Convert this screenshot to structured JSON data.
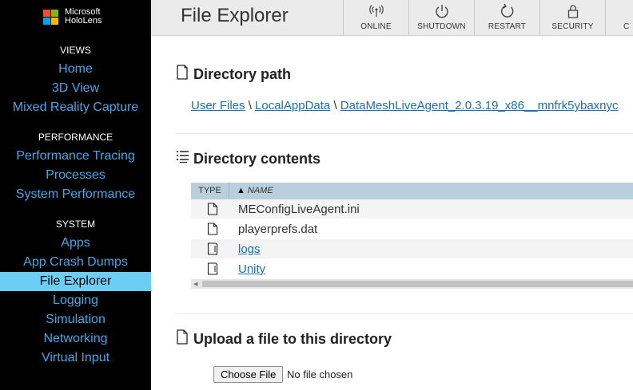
{
  "logo": {
    "line1": "Microsoft",
    "line2": "HoloLens",
    "colors": [
      "#f25022",
      "#7fba00",
      "#00a4ef",
      "#ffb900"
    ]
  },
  "sidebar": {
    "sections": [
      {
        "heading": "VIEWS",
        "items": [
          "Home",
          "3D View",
          "Mixed Reality Capture"
        ]
      },
      {
        "heading": "PERFORMANCE",
        "items": [
          "Performance Tracing",
          "Processes",
          "System Performance"
        ]
      },
      {
        "heading": "SYSTEM",
        "items": [
          "Apps",
          "App Crash Dumps",
          "File Explorer",
          "Logging",
          "Simulation",
          "Networking",
          "Virtual Input"
        ]
      }
    ],
    "active": "File Explorer"
  },
  "header": {
    "title": "File Explorer",
    "buttons": [
      {
        "label": "ONLINE",
        "icon": "wifi-antenna-icon"
      },
      {
        "label": "SHUTDOWN",
        "icon": "power-icon"
      },
      {
        "label": "RESTART",
        "icon": "restart-icon"
      },
      {
        "label": "SECURITY",
        "icon": "lock-icon"
      },
      {
        "label": "C",
        "icon": "unknown-icon"
      }
    ]
  },
  "directory_path": {
    "title": "Directory path",
    "crumbs": [
      "User Files",
      "LocalAppData",
      "DataMeshLiveAgent_2.0.3.19_x86__mnfrk5ybaxnyc"
    ],
    "separator": "\\"
  },
  "directory_contents": {
    "title": "Directory contents",
    "columns": {
      "type": "TYPE",
      "name": "NAME",
      "sort_arrow": "▲"
    },
    "rows": [
      {
        "type": "file",
        "name": "MEConfigLiveAgent.ini",
        "link": false
      },
      {
        "type": "file",
        "name": "playerprefs.dat",
        "link": false
      },
      {
        "type": "folder",
        "name": "logs",
        "link": true
      },
      {
        "type": "folder",
        "name": "Unity",
        "link": true
      }
    ]
  },
  "upload": {
    "title": "Upload a file to this directory",
    "button_label": "Choose File",
    "status": "No file chosen"
  },
  "colors": {
    "accent": "#3fa9e8",
    "active_bg": "#6ccdf5",
    "header_bg": "#ebebeb",
    "table_header": "#b9d0dc",
    "link": "#1a6fb5"
  }
}
